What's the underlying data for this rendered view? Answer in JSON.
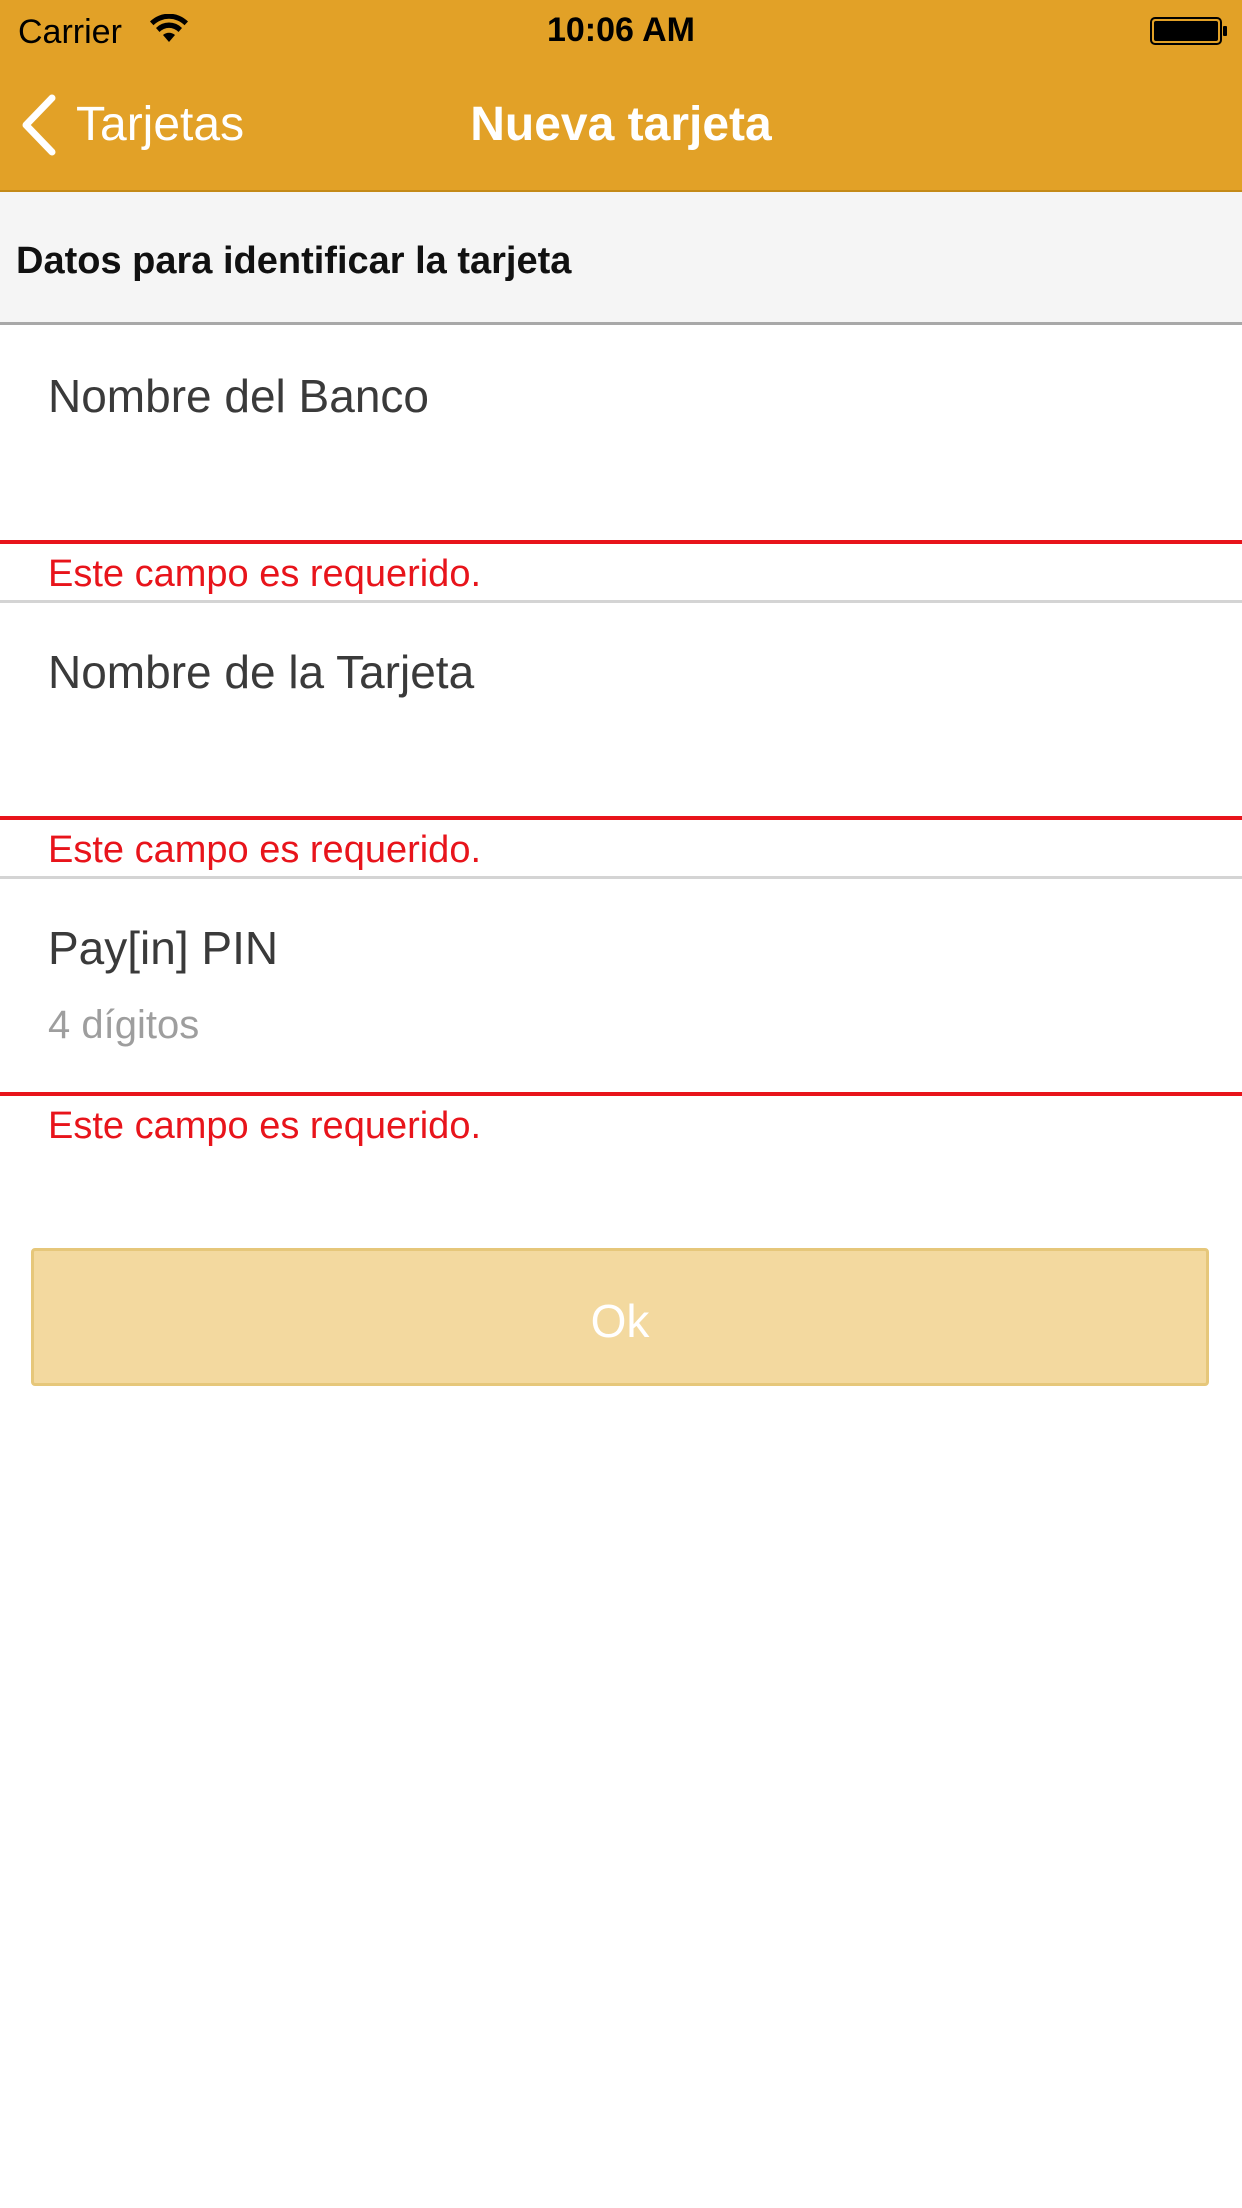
{
  "status_bar": {
    "carrier": "Carrier",
    "time": "10:06 AM",
    "wifi_icon": "wifi-icon",
    "battery_icon": "battery-icon"
  },
  "nav_bar": {
    "back_label": "Tarjetas",
    "back_icon": "chevron-left-icon",
    "title": "Nueva tarjeta",
    "color": "#E2A127"
  },
  "section": {
    "title": "Datos para identificar la tarjeta"
  },
  "form": {
    "fields": [
      {
        "label": "Nombre del Banco",
        "placeholder": "",
        "value": "",
        "error": "Este campo es requerido."
      },
      {
        "label": "Nombre de la Tarjeta",
        "placeholder": "",
        "value": "",
        "error": "Este campo es requerido."
      },
      {
        "label": "Pay[in] PIN",
        "placeholder": "4 dígitos",
        "value": "",
        "error": "Este campo es requerido."
      }
    ],
    "error_color": "#E8141B"
  },
  "actions": {
    "ok_label": "Ok",
    "ok_color": "#F3D99F"
  }
}
